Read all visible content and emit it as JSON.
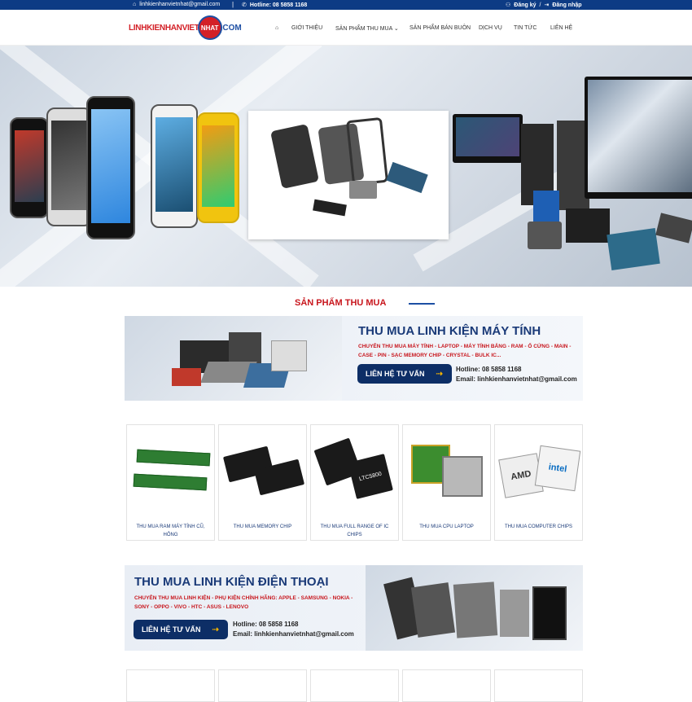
{
  "topbar": {
    "email": "linhkienhanvietnhat@gmail.com",
    "separator": "|",
    "hotline": "Hotline: 08 5858 1168",
    "register": "Đăng ký",
    "slash": "/",
    "login": "Đăng nhập"
  },
  "header": {
    "logo_part1": "LINHKIENHANVIET",
    "logo_circle": "NHAT",
    "logo_part2": ".COM"
  },
  "nav": {
    "items": [
      "GIỚI THIỆU",
      "SẢN PHẨM THU MUA",
      "SẢN PHẨM BÁN BUÔN",
      "DỊCH VỤ",
      "TIN TỨC",
      "LIÊN HỆ"
    ]
  },
  "section": {
    "title": "SẢN PHẨM THU MUA"
  },
  "banner1": {
    "title": "THU MUA LINH KIỆN MÁY TÍNH",
    "desc": "CHUYÊN THU MUA MÁY TÍNH - LAPTOP - MÁY TÍNH BẢNG - RAM - Ổ CỨNG - MAIN - CASE - PIN - SẠC MEMORY CHIP - CRYSTAL - BULK IC...",
    "button": "LIÊN HỆ TƯ VẤN",
    "hotline": "Hotline: 08 5858 1168",
    "email": "Email: linhkienhanvietnhat@gmail.com"
  },
  "products": [
    {
      "name": "THU MUA RAM MÁY TÍNH CŨ, HỎNG"
    },
    {
      "name": "THU MUA MEMORY CHIP"
    },
    {
      "name": "THU MUA FULL RANGE OF IC CHIPS"
    },
    {
      "name": "THU MUA CPU LAPTOP"
    },
    {
      "name": "THU MUA COMPUTER CHIPS"
    }
  ],
  "banner2": {
    "title": "THU MUA LINH KIỆN ĐIỆN THOẠI",
    "desc": "CHUYÊN THU MUA LINH KIỆN - PHỤ KIỆN CHÍNH HÃNG: APPLE - SAMSUNG - NOKIA - SONY - OPPO - VIVO - HTC - ASUS - LENOVO",
    "button": "LIÊN HỆ TƯ VẤN",
    "hotline": "Hotline:  08 5858 1168",
    "email": "Email:  linhkienhanvietnhat@gmail.com"
  },
  "chip_labels": {
    "ltc": "LTC5800",
    "amd": "AMD",
    "intel": "intel"
  },
  "colors": {
    "topbar": "#0d3b84",
    "accent_red": "#c8161d",
    "accent_blue": "#1a3a78"
  }
}
